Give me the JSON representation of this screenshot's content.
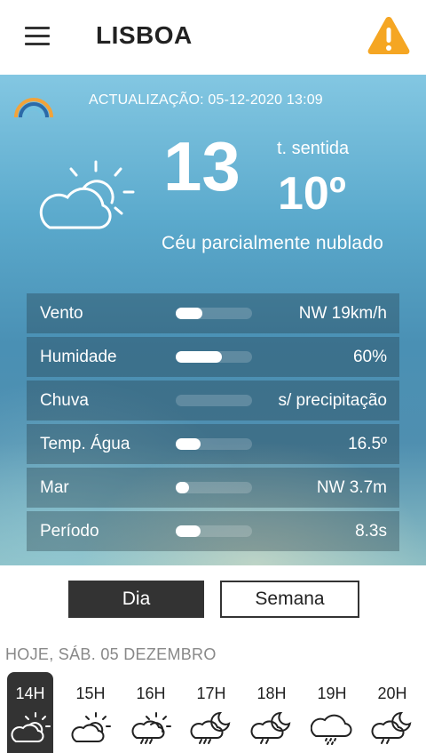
{
  "header": {
    "city": "LISBOA",
    "menu_icon": "hamburger-menu-icon",
    "warning_icon": "warning-triangle-icon",
    "warning_color": "#F5A623"
  },
  "hero": {
    "updated": "ACTUALIZAÇÃO: 05-12-2020 13:09",
    "temperature": "13",
    "feels_label": "t. sentida",
    "feels_value": "10º",
    "description": "Céu parcialmente nublado",
    "weather_icon": "partly-cloudy-day-icon",
    "logo_icon": "rainbow-logo-icon"
  },
  "details": [
    {
      "label": "Vento",
      "value": "NW 19km/h",
      "level": 0.35
    },
    {
      "label": "Humidade",
      "value": "60%",
      "level": 0.6
    },
    {
      "label": "Chuva",
      "value": "s/ precipitação",
      "level": 0
    },
    {
      "label": "Temp. Água",
      "value": "16.5º",
      "level": 0.33
    },
    {
      "label": "Mar",
      "value": "NW 3.7m",
      "level": 0.18
    },
    {
      "label": "Período",
      "value": "8.3s",
      "level": 0.33
    }
  ],
  "tabs": {
    "day": "Dia",
    "week": "Semana",
    "selected": "Dia"
  },
  "date_label": "HOJE, SÁB. 05 DEZEMBRO",
  "hours": [
    {
      "label": "14H",
      "icon": "partly-cloudy-day-icon"
    },
    {
      "label": "15H",
      "icon": "partly-cloudy-day-icon"
    },
    {
      "label": "16H",
      "icon": "rain-sun-cloud-icon"
    },
    {
      "label": "17H",
      "icon": "rain-moon-cloud-icon"
    },
    {
      "label": "18H",
      "icon": "rain-moon-cloud-icon"
    },
    {
      "label": "19H",
      "icon": "drizzle-cloud-icon"
    },
    {
      "label": "20H",
      "icon": "rain-moon-cloud-icon"
    }
  ],
  "colors": {
    "dark": "#333333",
    "accent_warning": "#F5A623"
  }
}
